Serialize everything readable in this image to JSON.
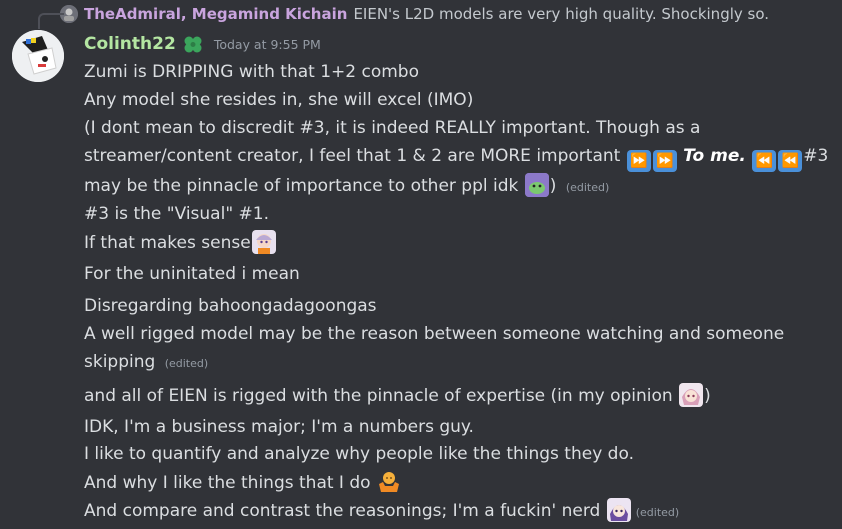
{
  "reply": {
    "author": "TheAdmiral, Megamind Kichain",
    "text": "EIEN's L2D models are very high quality. Shockingly so."
  },
  "message": {
    "username": "Colinth22",
    "timestamp": "Today at 9:55 PM",
    "role_icon": "clover-icon",
    "colors": {
      "username": "#b4e6a2",
      "reply_author": "#c9a4de",
      "background": "#313338"
    }
  },
  "lines": {
    "l1": "Zumi is DRIPPING with that 1+2 combo",
    "l2": "Any model she resides in, she will excel (IMO)",
    "l3": "(I dont mean to discredit #3, it is indeed REALLY important. Though as a",
    "l4a": "streamer/content creator, I feel that 1 & 2 are MORE important",
    "l4b": "To me.",
    "l4c": "#3",
    "l5a": "may be the pinnacle of importance to other ppl idk",
    "l5b": ")",
    "l6": "#3 is the \"Visual\" #1.",
    "l7": "If that makes sense",
    "l8": "For the uninitated i mean",
    "l9": "Disregarding bahoongadagoongas",
    "l10": "A well rigged model may be the reason between someone watching and someone",
    "l11": "skipping",
    "l12a": "and all of EIEN is rigged with the pinnacle of expertise (in my opinion",
    "l12b": ")",
    "l13": "IDK, I'm a business major; I'm a numbers guy.",
    "l14": "I like to quantify and analyze why people like the things they do.",
    "l15": "And why I like the things that I do",
    "l16": "And compare and contrast the reasonings; I'm a fuckin' nerd"
  },
  "edited_label": "(edited)",
  "icons": {
    "fast_forward": "fast-forward-icon",
    "rewind": "rewind-icon",
    "ff_glyph": "⏩",
    "rw_glyph": "⏪"
  }
}
